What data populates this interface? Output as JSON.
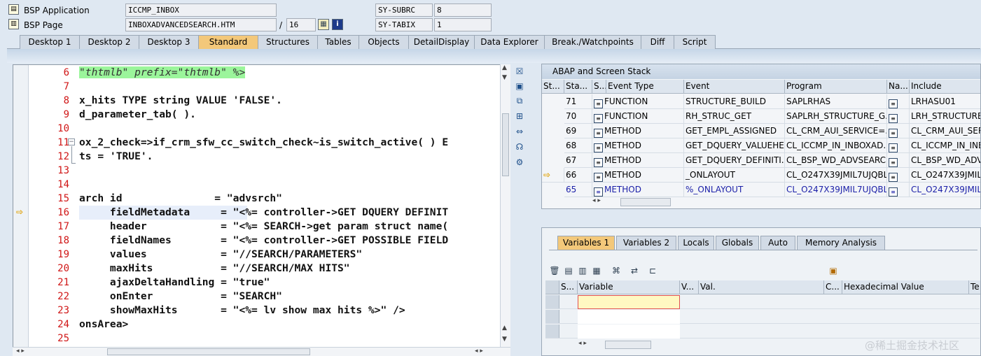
{
  "header": {
    "bsp_app_label": "BSP Application",
    "bsp_app_value": "ICCMP_INBOX",
    "bsp_page_label": "BSP Page",
    "bsp_page_value": "INBOXADVANCEDSEARCH.HTM",
    "page_sep": "/",
    "page_line": "16",
    "subrc_label": "SY-SUBRC",
    "subrc_value": "8",
    "tabix_label": "SY-TABIX",
    "tabix_value": "1"
  },
  "tabs": [
    "Desktop 1",
    "Desktop 2",
    "Desktop 3",
    "Standard",
    "Structures",
    "Tables",
    "Objects",
    "DetailDisplay",
    "Data Explorer",
    "Break./Watchpoints",
    "Diff",
    "Script"
  ],
  "active_tab": "Standard",
  "editor": {
    "lines": [
      {
        "n": "6",
        "code": "\"thtmlb\" prefix=\"thtmlb\" %>"
      },
      {
        "n": "7",
        "code": ""
      },
      {
        "n": "8",
        "code": "x_hits TYPE string VALUE 'FALSE'."
      },
      {
        "n": "9",
        "code": "d_parameter_tab( )."
      },
      {
        "n": "10",
        "code": ""
      },
      {
        "n": "11",
        "code": "ox_2_check=>if_crm_sfw_cc_switch_check~is_switch_active( ) E"
      },
      {
        "n": "12",
        "code": "ts = 'TRUE'."
      },
      {
        "n": "13",
        "code": ""
      },
      {
        "n": "14",
        "code": ""
      },
      {
        "n": "15",
        "code": "arch id               = \"advsrch\""
      },
      {
        "n": "16",
        "code": "     fieldMetadata     = \"<%= controller->GET DQUERY DEFINIT"
      },
      {
        "n": "17",
        "code": "     header            = \"<%= SEARCH->get param struct name("
      },
      {
        "n": "18",
        "code": "     fieldNames        = \"<%= controller->GET POSSIBLE FIELD"
      },
      {
        "n": "19",
        "code": "     values            = \"//SEARCH/PARAMETERS\""
      },
      {
        "n": "20",
        "code": "     maxHits           = \"//SEARCH/MAX HITS\""
      },
      {
        "n": "21",
        "code": "     ajaxDeltaHandling = \"true\""
      },
      {
        "n": "22",
        "code": "     onEnter           = \"SEARCH\""
      },
      {
        "n": "23",
        "code": "     showMaxHits       = \"<%= lv show max hits %>\" />"
      },
      {
        "n": "24",
        "code": "onsArea>"
      },
      {
        "n": "25",
        "code": ""
      }
    ],
    "current_line": "16"
  },
  "stack": {
    "title": "ABAP and Screen Stack",
    "columns": [
      "St...",
      "Sta...",
      "S...",
      "Event Type",
      "Event",
      "Program",
      "Na...",
      "Include"
    ],
    "rows": [
      {
        "sta": "71",
        "type": "FUNCTION",
        "event": "STRUCTURE_BUILD",
        "program": "SAPLRHAS",
        "include": "LRHASU01"
      },
      {
        "sta": "70",
        "type": "FUNCTION",
        "event": "RH_STRUC_GET",
        "program": "SAPLRH_STRUCTURE_G...",
        "include": "LRH_STRUCTURE_"
      },
      {
        "sta": "69",
        "type": "METHOD",
        "event": "GET_EMPL_ASSIGNED",
        "program": "CL_CRM_AUI_SERVICE=...",
        "include": "CL_CRM_AUI_SERV"
      },
      {
        "sta": "68",
        "type": "METHOD",
        "event": "GET_DQUERY_VALUEHE...",
        "program": "CL_ICCMP_IN_INBOXAD...",
        "include": "CL_ICCMP_IN_INBO"
      },
      {
        "sta": "67",
        "type": "METHOD",
        "event": "GET_DQUERY_DEFINITI...",
        "program": "CL_BSP_WD_ADVSEARC...",
        "include": "CL_BSP_WD_ADVS"
      },
      {
        "sta": "66",
        "type": "METHOD",
        "event": "_ONLAYOUT",
        "program": "CL_O247X39JMIL7UJQBL...",
        "include": "CL_O247X39JMIL7"
      },
      {
        "sta": "65",
        "type": "METHOD",
        "event": "%_ONLAYOUT",
        "program": "CL_O247X39JMIL7UJQBL...",
        "include": "CL_O247X39JMIL7"
      }
    ]
  },
  "variables": {
    "tabs": [
      "Variables 1",
      "Variables 2",
      "Locals",
      "Globals",
      "Auto",
      "Memory Analysis"
    ],
    "active_tab": "Variables 1",
    "columns": [
      "S...",
      "Variable",
      "V...",
      "Val.",
      "C...",
      "Hexadecimal Value",
      "Te"
    ]
  },
  "watermark": "@稀土掘金技术社区"
}
